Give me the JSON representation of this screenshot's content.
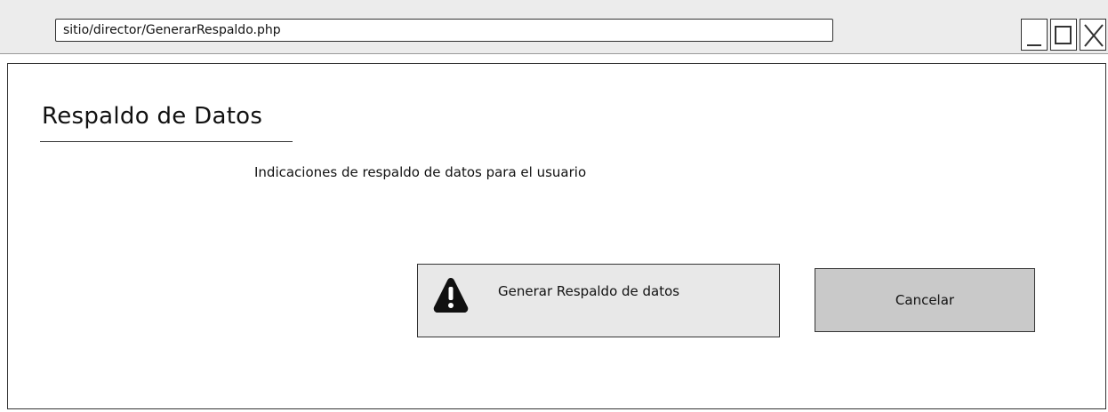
{
  "browser": {
    "url": "sitio/director/GenerarRespaldo.php",
    "controls": {
      "minimize_icon": "minimize-icon",
      "maximize_icon": "maximize-icon",
      "close_icon": "close-icon"
    }
  },
  "page": {
    "title": "Respaldo de Datos",
    "instructions": "Indicaciones de respaldo de datos para el usuario"
  },
  "actions": {
    "generate_label": "Generar Respaldo de datos",
    "generate_icon": "warning-icon",
    "cancel_label": "Cancelar"
  },
  "colors": {
    "generate_bg": "#e8e8e8",
    "cancel_bg": "#c9c9c9",
    "titlebar_bg": "#ececec"
  }
}
